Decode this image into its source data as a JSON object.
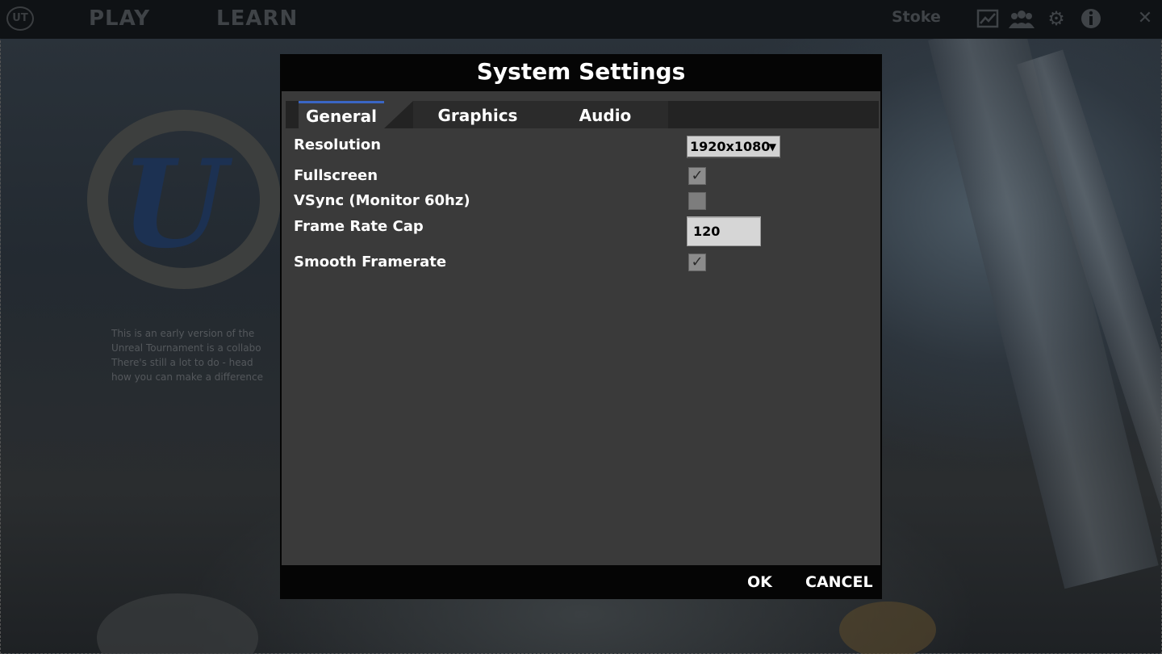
{
  "topbar": {
    "logo_text": "UT",
    "nav": [
      {
        "label": "PLAY"
      },
      {
        "label": "LEARN"
      }
    ],
    "username": "Stoke",
    "icons": {
      "stats": "chart-icon",
      "friends": "friends-icon",
      "settings": "gear-icon",
      "info": "info-icon",
      "close": "close-icon"
    }
  },
  "background": {
    "blurb": "This is an early version of the\nUnreal Tournament is a collabo\nThere's still a lot to do - head\nhow you can make a difference"
  },
  "dialog": {
    "title": "System Settings",
    "tabs": [
      {
        "label": "General",
        "active": true
      },
      {
        "label": "Graphics",
        "active": false
      },
      {
        "label": "Audio",
        "active": false
      }
    ],
    "settings": {
      "resolution": {
        "label": "Resolution",
        "value": "1920x1080"
      },
      "fullscreen": {
        "label": "Fullscreen",
        "checked": true
      },
      "vsync": {
        "label": "VSync (Monitor 60hz)",
        "checked": false
      },
      "frame_rate_cap": {
        "label": "Frame Rate Cap",
        "value": "120"
      },
      "smooth_framerate": {
        "label": "Smooth Framerate",
        "checked": true
      }
    },
    "buttons": {
      "ok": "OK",
      "cancel": "CANCEL"
    }
  },
  "colors": {
    "accent": "#3a66c4",
    "panel": "#3a3a3a",
    "frame": "#050505"
  }
}
